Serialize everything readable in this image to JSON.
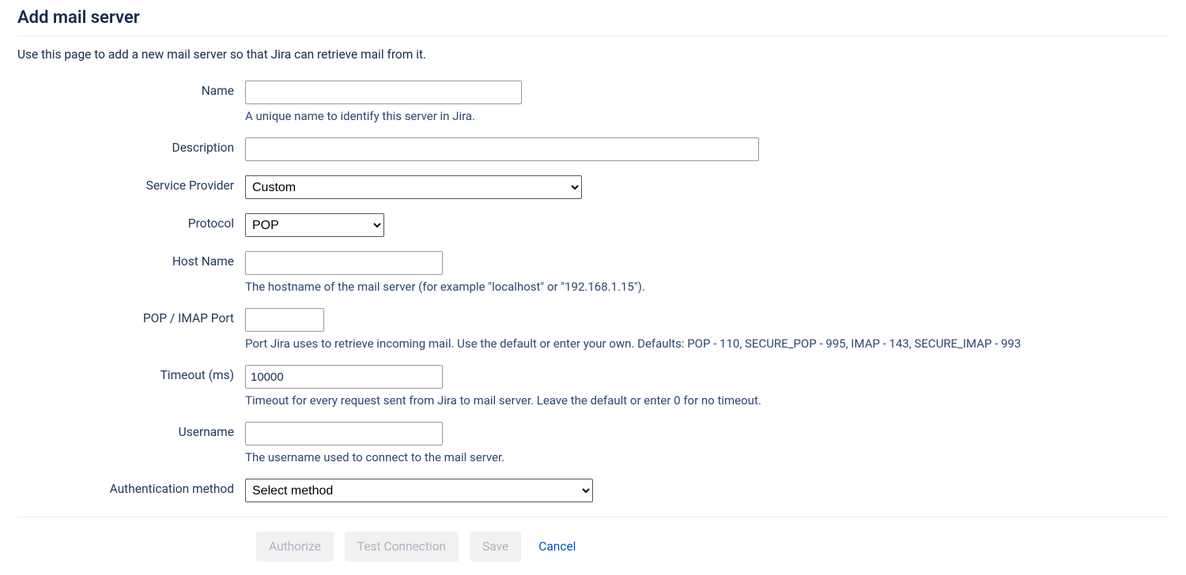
{
  "header": {
    "title": "Add mail server",
    "intro": "Use this page to add a new mail server so that Jira can retrieve mail from it."
  },
  "fields": {
    "name": {
      "label": "Name",
      "value": "",
      "help": "A unique name to identify this server in Jira."
    },
    "description": {
      "label": "Description",
      "value": ""
    },
    "serviceProvider": {
      "label": "Service Provider",
      "selected": "Custom",
      "options": [
        "Custom"
      ]
    },
    "protocol": {
      "label": "Protocol",
      "selected": "POP",
      "options": [
        "POP"
      ]
    },
    "hostName": {
      "label": "Host Name",
      "value": "",
      "help": "The hostname of the mail server (for example \"localhost\" or \"192.168.1.15\")."
    },
    "port": {
      "label": "POP / IMAP Port",
      "value": "",
      "help": "Port Jira uses to retrieve incoming mail. Use the default or enter your own. Defaults: POP - 110, SECURE_POP - 995, IMAP - 143, SECURE_IMAP - 993"
    },
    "timeout": {
      "label": "Timeout (ms)",
      "value": "10000",
      "help": "Timeout for every request sent from Jira to mail server. Leave the default or enter 0 for no timeout."
    },
    "username": {
      "label": "Username",
      "value": "",
      "help": "The username used to connect to the mail server."
    },
    "authMethod": {
      "label": "Authentication method",
      "selected": "Select method",
      "options": [
        "Select method"
      ]
    }
  },
  "buttons": {
    "authorize": "Authorize",
    "testConnection": "Test Connection",
    "save": "Save",
    "cancel": "Cancel"
  }
}
